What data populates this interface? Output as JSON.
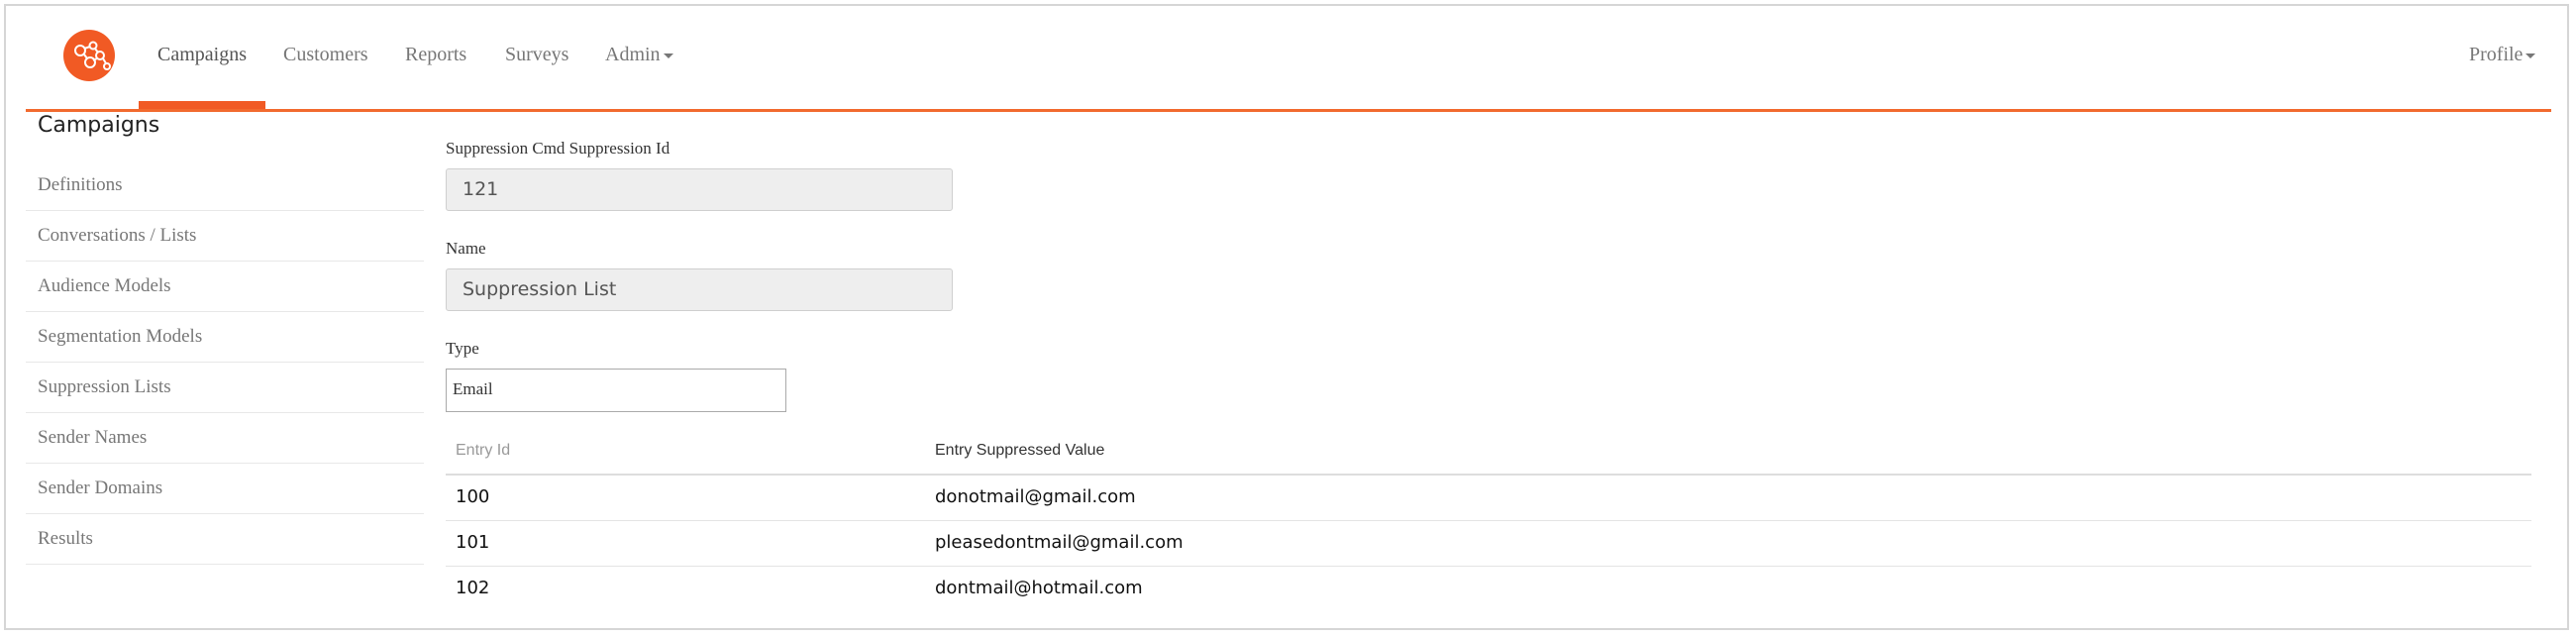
{
  "nav": {
    "items": [
      {
        "label": "Campaigns",
        "active": true
      },
      {
        "label": "Customers"
      },
      {
        "label": "Reports"
      },
      {
        "label": "Surveys"
      },
      {
        "label": "Admin",
        "dropdown": true
      }
    ],
    "profile": "Profile",
    "accent_color": "#f15a24"
  },
  "sidebar": {
    "title": "Campaigns",
    "items": [
      {
        "label": "Definitions"
      },
      {
        "label": "Conversations / Lists"
      },
      {
        "label": "Audience Models"
      },
      {
        "label": "Segmentation Models"
      },
      {
        "label": "Suppression Lists"
      },
      {
        "label": "Sender Names"
      },
      {
        "label": "Sender Domains"
      },
      {
        "label": "Results"
      }
    ]
  },
  "form": {
    "id_label": "Suppression Cmd Suppression Id",
    "id_value": "121",
    "name_label": "Name",
    "name_value": "Suppression List",
    "type_label": "Type",
    "type_value": "Email"
  },
  "table": {
    "headers": [
      "Entry Id",
      "Entry Suppressed Value"
    ],
    "rows": [
      [
        "100",
        "donotmail@gmail.com"
      ],
      [
        "101",
        "pleasedontmail@gmail.com"
      ],
      [
        "102",
        "dontmail@hotmail.com"
      ]
    ]
  }
}
